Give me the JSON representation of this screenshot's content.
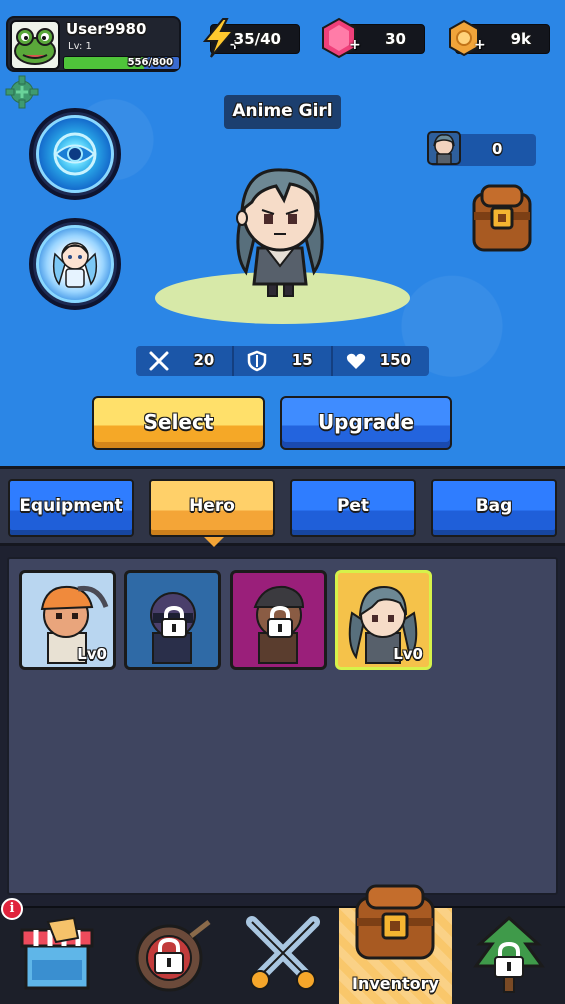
{
  "user": {
    "name": "User9980",
    "level": "Lv: 1",
    "xp_text": "556/800",
    "xp_fraction": 0.695
  },
  "currency": {
    "energy": "35/40",
    "gems": "30",
    "coins": "9k"
  },
  "hero": {
    "name": "Anime Girl",
    "skin_count": "0",
    "stats": {
      "attack": "20",
      "defense": "15",
      "health": "150"
    }
  },
  "actions": {
    "select_label": "Select",
    "upgrade_label": "Upgrade"
  },
  "tabs": [
    {
      "label": "Equipment",
      "active": false
    },
    {
      "label": "Hero",
      "active": true
    },
    {
      "label": "Pet",
      "active": false
    },
    {
      "label": "Bag",
      "active": false
    }
  ],
  "heroes": [
    {
      "name": "miner",
      "level": "Lv0",
      "locked": false,
      "bg": "#b9d6f0"
    },
    {
      "name": "ninja",
      "level": "",
      "locked": true,
      "bg": "#2f6aa6"
    },
    {
      "name": "bandit",
      "level": "",
      "locked": true,
      "bg": "#9a1f7a"
    },
    {
      "name": "anime-girl",
      "level": "Lv0",
      "locked": false,
      "bg": "#f5c24a",
      "selected": true
    }
  ],
  "nav": {
    "inventory_label": "Inventory",
    "badge": "i"
  },
  "colors": {
    "background": "#2b86e6",
    "select_button": "#f5a827",
    "upgrade_button": "#2364de",
    "selected_card_border": "#d6f24a"
  }
}
